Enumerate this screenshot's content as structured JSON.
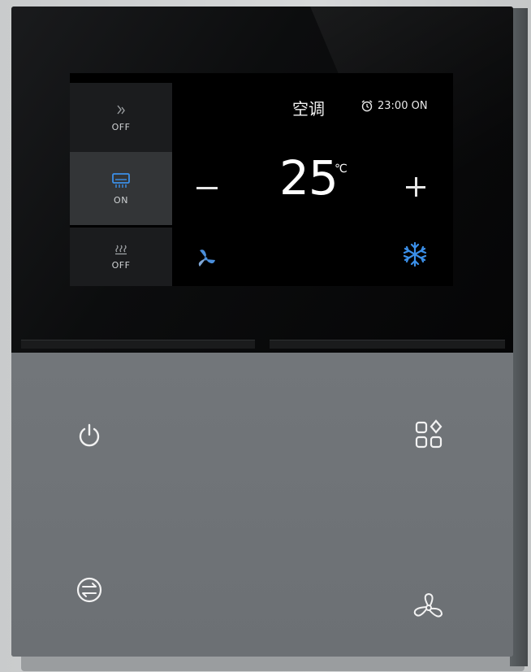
{
  "screen": {
    "mode_label": "空调",
    "timer_text": "23:00 ON",
    "temperature": "25",
    "temperature_unit": "℃",
    "sidebar": [
      {
        "icon": "floor-heat-icon",
        "status": "OFF"
      },
      {
        "icon": "air-conditioner-icon",
        "status": "ON"
      },
      {
        "icon": "heating-icon",
        "status": "OFF"
      }
    ]
  },
  "buttons": {
    "power": "power-icon",
    "scenes": "scenes-grid-icon",
    "mode": "mode-switch-icon",
    "fan": "fan-icon"
  },
  "colors": {
    "accent_blue": "#3b8fe8",
    "fan_blue": "#4a8fdc",
    "screen_bg": "#000000",
    "panel_gray": "#6f7376"
  }
}
